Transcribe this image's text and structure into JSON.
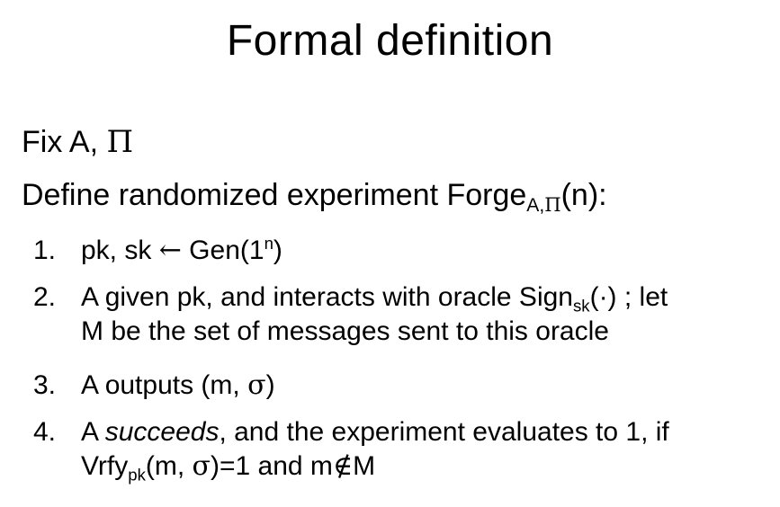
{
  "title": "Formal definition",
  "fix_line": {
    "prefix": "Fix A, ",
    "pi": "Π"
  },
  "define_line": {
    "text": "Define randomized experiment Forge",
    "subscript_a": "A,",
    "subscript_pi": "Π",
    "suffix": "(n):"
  },
  "steps": [
    {
      "number": "1.",
      "pre": "pk, sk ",
      "arrow": "←",
      "post": " Gen(1",
      "sup": "n",
      "end": ")"
    },
    {
      "number": "2.",
      "line1_pre": "A given pk, and interacts with oracle Sign",
      "line1_sub": "sk",
      "line1_post": "(·) ; let",
      "line2": "M be the set of messages sent to this oracle"
    },
    {
      "number": "3.",
      "pre": "A outputs (m, ",
      "sigma": "σ",
      "post": ")"
    },
    {
      "number": "4.",
      "line1_pre": "A ",
      "line1_em": "succeeds",
      "line1_post": ", and the experiment evaluates to 1, if",
      "line2_pre": "Vrfy",
      "line2_sub": "pk",
      "line2_mid": "(m, ",
      "line2_sigma": "σ",
      "line2_post": ")=1 and m",
      "line2_notin": "∉",
      "line2_end": "M"
    }
  ]
}
